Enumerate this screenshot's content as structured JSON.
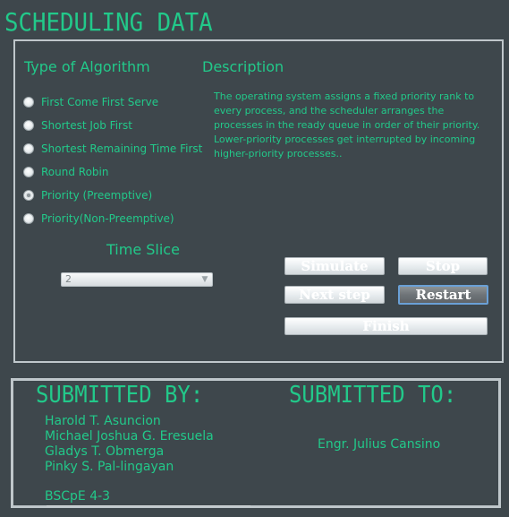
{
  "app": {
    "title": "SCHEDULING DATA"
  },
  "type_of_algorithm": {
    "label": "Type of Algorithm",
    "options": [
      {
        "label": "First Come First Serve",
        "checked": false
      },
      {
        "label": "Shortest Job First",
        "checked": false
      },
      {
        "label": "Shortest Remaining Time First",
        "checked": false
      },
      {
        "label": "Round Robin",
        "checked": false
      },
      {
        "label": "Priority (Preemptive)",
        "checked": true
      },
      {
        "label": "Priority(Non-Preemptive)",
        "checked": false
      }
    ]
  },
  "description": {
    "label": "Description",
    "text": "The operating system assigns a fixed priority rank to every process, and the scheduler arranges the processes in the ready queue in order of their priority. Lower-priority processes get interrupted by incoming higher-priority processes.."
  },
  "time_slice": {
    "label": "Time Slice",
    "selected_value": "2"
  },
  "buttons": {
    "simulate": "Simulate",
    "stop": "Stop",
    "next_step": "Next step",
    "restart": "Restart",
    "finish": "Finish"
  },
  "footer": {
    "submitted_by_label": "SUBMITTED BY:",
    "submitted_to_label": "SUBMITTED TO:",
    "members": [
      "Harold T. Asuncion",
      "Michael Joshua G. Eresuela",
      "Gladys T. Obmerga",
      "Pinky S. Pal-lingayan"
    ],
    "section": "BSCpE 4-3",
    "recipient": "Engr. Julius Cansino"
  },
  "colors": {
    "background": "#3e474c",
    "accent": "#22c98a",
    "panel_border": "#bfc7cb"
  },
  "icons": {
    "select_arrow": "chevron-down-icon"
  }
}
